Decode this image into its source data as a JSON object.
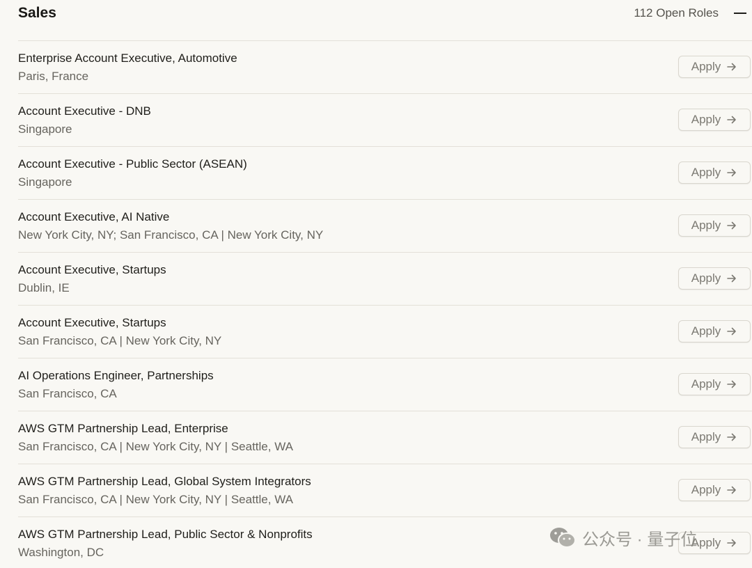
{
  "section": {
    "title": "Sales",
    "open_roles": "112 Open Roles"
  },
  "roles": [
    {
      "title": "Enterprise Account Executive, Automotive",
      "location": "Paris, France",
      "apply_label": "Apply"
    },
    {
      "title": "Account Executive - DNB",
      "location": "Singapore",
      "apply_label": "Apply"
    },
    {
      "title": "Account Executive - Public Sector (ASEAN)",
      "location": "Singapore",
      "apply_label": "Apply"
    },
    {
      "title": "Account Executive, AI Native",
      "location": "New York City, NY; San Francisco, CA | New York City, NY",
      "apply_label": "Apply"
    },
    {
      "title": "Account Executive, Startups",
      "location": "Dublin, IE",
      "apply_label": "Apply"
    },
    {
      "title": "Account Executive, Startups",
      "location": "San Francisco, CA | New York City, NY",
      "apply_label": "Apply"
    },
    {
      "title": "AI Operations Engineer, Partnerships",
      "location": "San Francisco, CA",
      "apply_label": "Apply"
    },
    {
      "title": "AWS GTM Partnership Lead, Enterprise",
      "location": "San Francisco, CA | New York City, NY | Seattle, WA",
      "apply_label": "Apply"
    },
    {
      "title": "AWS GTM Partnership Lead, Global System Integrators",
      "location": "San Francisco, CA | New York City, NY | Seattle, WA",
      "apply_label": "Apply"
    },
    {
      "title": "AWS GTM Partnership Lead, Public Sector & Nonprofits",
      "location": "Washington, DC",
      "apply_label": "Apply"
    }
  ],
  "icons": {
    "collapse": "minus-icon",
    "apply_arrow": "arrow-right-icon",
    "watermark_logo": "wechat-icon"
  },
  "watermark": {
    "text": "公众号 · 量子位"
  },
  "colors": {
    "background": "#f9f8f4",
    "text": "#1f1e1a",
    "muted": "#66645e",
    "divider": "#e3e0d8",
    "button_border": "#d9d6ce"
  }
}
